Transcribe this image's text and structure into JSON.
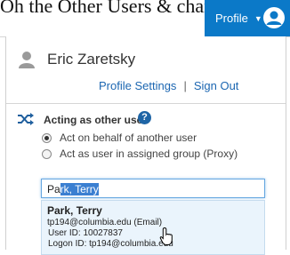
{
  "top_bar": {
    "partial_text": "Oh the Other Users & change app settings",
    "profile_label": "Profile",
    "brand_color": "#0b79c8"
  },
  "user": {
    "name": "Eric Zaretsky",
    "profile_settings_link": "Profile Settings",
    "separator": "|",
    "sign_out_link": "Sign Out"
  },
  "acting": {
    "title": "Acting as other user",
    "help_glyph": "?",
    "options": [
      {
        "label": "Act on behalf of another user",
        "checked": true
      },
      {
        "label": "Act as user in assigned group (Proxy)",
        "checked": false
      }
    ]
  },
  "search": {
    "typed": "Pa",
    "selected": "rk, Terry"
  },
  "result": {
    "name": "Park, Terry",
    "email_line": "tp194@columbia.edu (Email)",
    "user_id_line": "User ID: 10027837",
    "logon_line": "Logon ID: tp194@columbia.edu"
  },
  "icons": {
    "profile_avatar": "user-avatar-icon",
    "user": "user-icon",
    "acting": "shuffle-icon",
    "help": "help-icon",
    "cursor": "hand-pointer-icon"
  }
}
